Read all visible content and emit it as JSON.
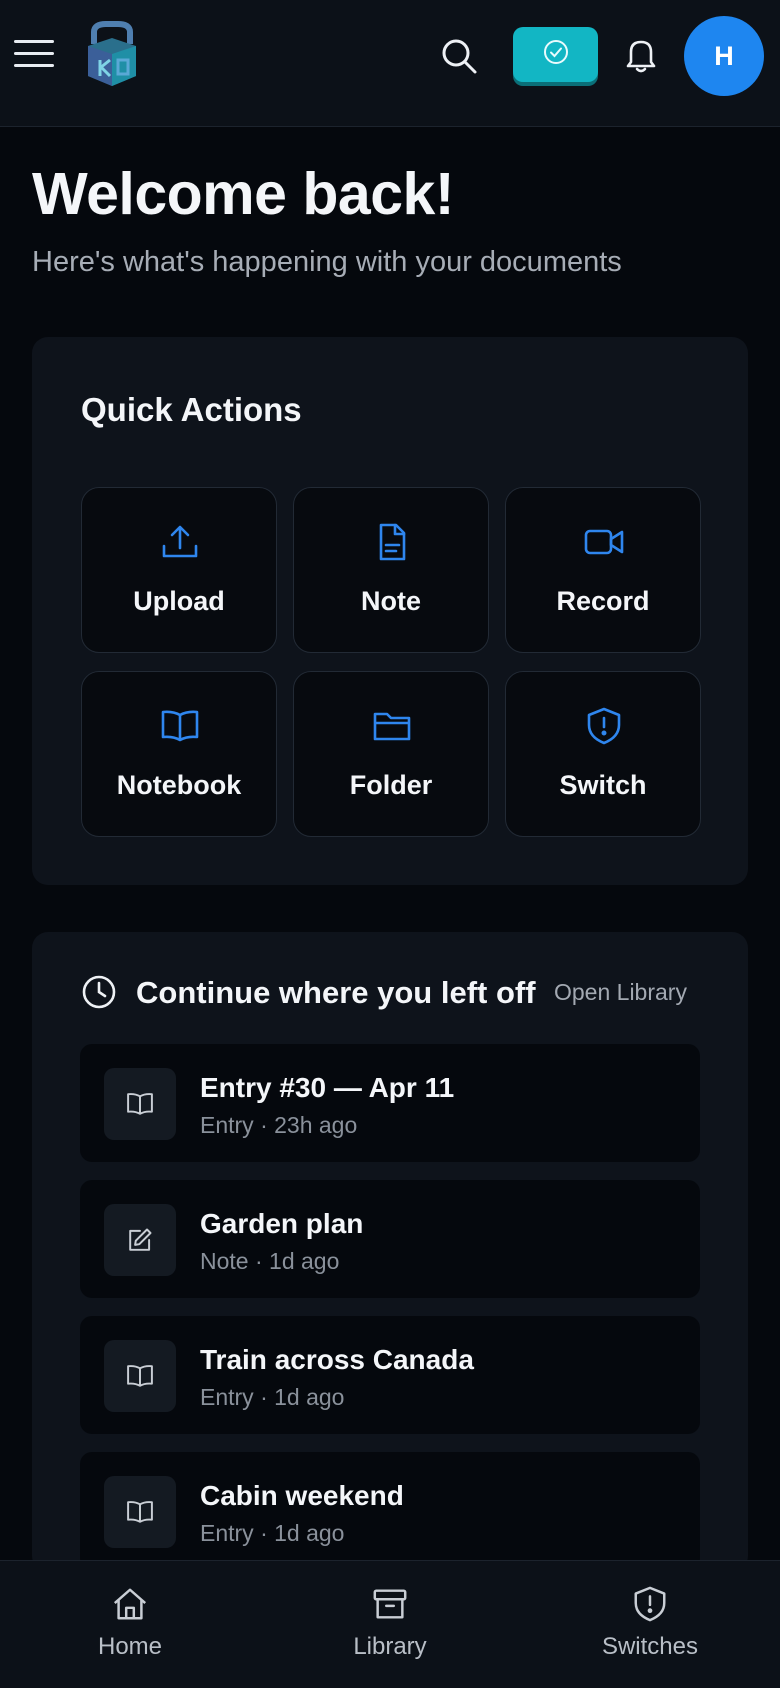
{
  "header": {
    "menu_icon": "hamburger-menu-icon",
    "logo_icon": "app-logo",
    "search_icon": "search-icon",
    "status_icon": "check-circle-icon",
    "bell_icon": "bell-icon",
    "avatar_initial": "H",
    "accent_color": "#12b6c4",
    "avatar_color": "#1e86f0"
  },
  "welcome": {
    "title": "Welcome back!",
    "subtitle": "Here's what's happening with your documents"
  },
  "quick_actions": {
    "title": "Quick Actions",
    "items": [
      {
        "label": "Upload",
        "icon": "upload-icon"
      },
      {
        "label": "Note",
        "icon": "document-icon"
      },
      {
        "label": "Record",
        "icon": "video-camera-icon"
      },
      {
        "label": "Notebook",
        "icon": "book-open-icon"
      },
      {
        "label": "Folder",
        "icon": "folder-icon"
      },
      {
        "label": "Switch",
        "icon": "shield-alert-icon"
      }
    ],
    "icon_color": "#2f86ee"
  },
  "recent": {
    "title": "Continue where you left off",
    "link": "Open Library",
    "items": [
      {
        "title": "Entry #30 — Apr 11",
        "meta": "Entry · 23h ago",
        "icon": "book-open-icon"
      },
      {
        "title": "Garden plan",
        "meta": "Note · 1d ago",
        "icon": "pencil-square-icon"
      },
      {
        "title": "Train across Canada",
        "meta": "Entry · 1d ago",
        "icon": "book-open-icon"
      },
      {
        "title": "Cabin weekend",
        "meta": "Entry · 1d ago",
        "icon": "book-open-icon"
      }
    ]
  },
  "bottom_nav": {
    "items": [
      {
        "label": "Home",
        "icon": "home-icon"
      },
      {
        "label": "Library",
        "icon": "archive-box-icon"
      },
      {
        "label": "Switches",
        "icon": "shield-alert-icon"
      }
    ]
  }
}
